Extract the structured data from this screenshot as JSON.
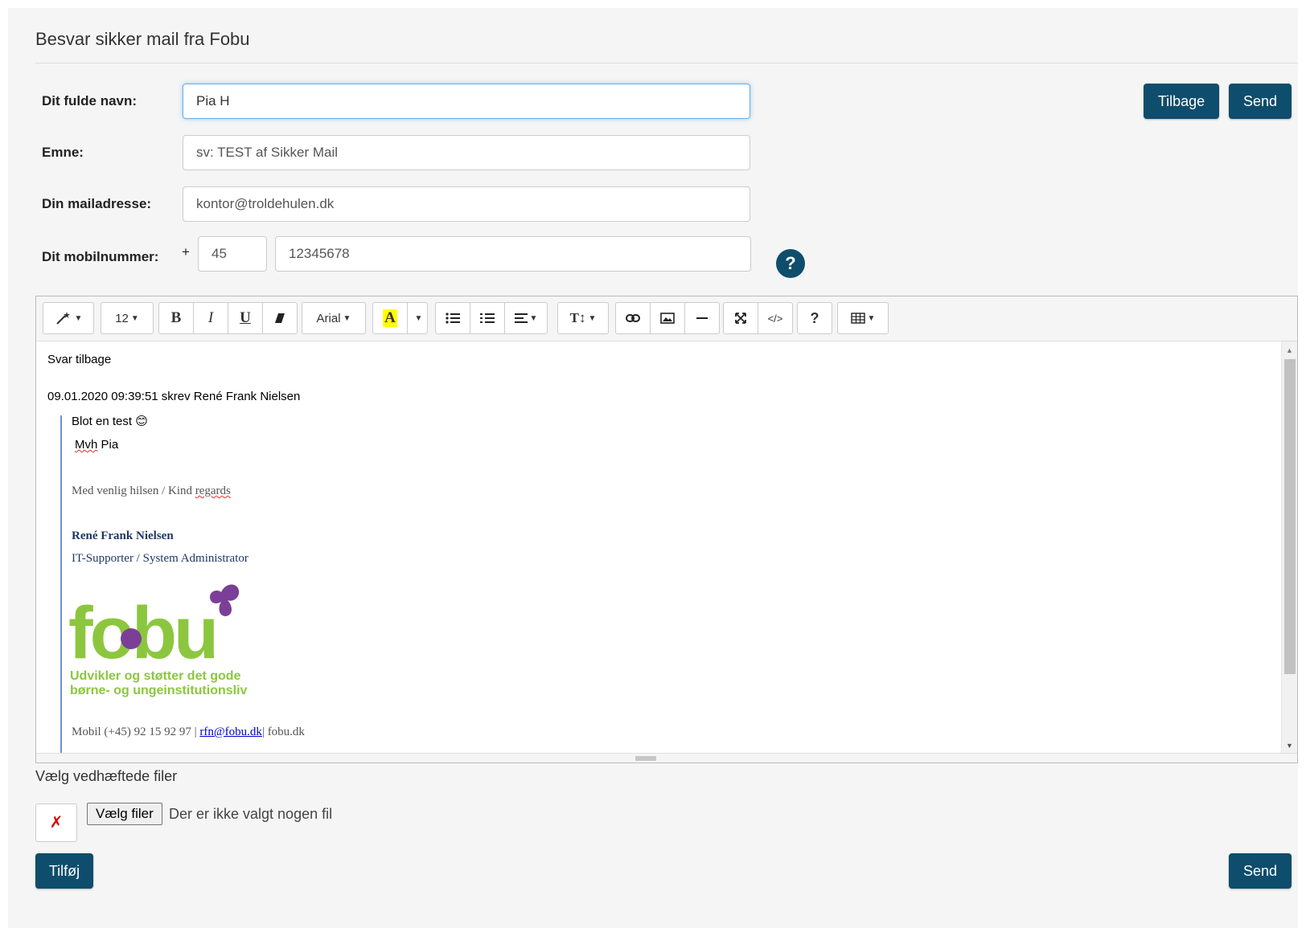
{
  "page": {
    "title": "Besvar sikker mail fra Fobu"
  },
  "form": {
    "name_label": "Dit fulde navn:",
    "name_value": "Pia H",
    "subject_label": "Emne:",
    "subject_value": "sv: TEST af Sikker Mail",
    "email_label": "Din mailadresse:",
    "email_value": "kontor@troldehulen.dk",
    "mobile_label": "Dit mobilnummer:",
    "mobile_plus": "+",
    "mobile_prefix": "45",
    "mobile_number": "12345678",
    "help_symbol": "?"
  },
  "header_buttons": {
    "back": "Tilbage",
    "send": "Send"
  },
  "toolbar": {
    "magic": "magic-wand-icon",
    "font_size": "12",
    "bold": "B",
    "italic": "I",
    "underline": "U",
    "eraser": "eraser-icon",
    "font_name": "Arial",
    "color": "A",
    "highlight_color": "#ffff00",
    "unordered_list": "unordered-list-icon",
    "ordered_list": "ordered-list-icon",
    "align": "align-icon",
    "line_height": "T↕",
    "link": "link-icon",
    "picture": "picture-icon",
    "hr": "horizontal-rule-icon",
    "fullscreen": "fullscreen-icon",
    "codeview": "</>",
    "help": "?",
    "table": "table-icon"
  },
  "editor": {
    "reply_text": "Svar tilbage",
    "quote_header": "09.01.2020 09:39:51 skrev René Frank Nielsen",
    "line1": "Blot en test",
    "emoji": "😊",
    "greeting_word": "Mvh",
    "greeting_name": " Pia",
    "regards_prefix": "Med venlig hilsen / Kind ",
    "regards_word": "regards",
    "sig_name": "René Frank Nielsen",
    "sig_title": "IT-Supporter / System Administrator",
    "logo_text": "fobu",
    "tagline1": "Udvikler og støtter det gode",
    "tagline2": "børne- og ungeinstitutionsliv",
    "contact_prefix": "Mobil (+45) 92 15 92 97 | ",
    "contact_email": "rfn@fobu.dk",
    "contact_suffix": "| fobu.dk"
  },
  "attachments": {
    "label": "Vælg vedhæftede filer",
    "remove_symbol": "✗",
    "choose_button": "Vælg filer",
    "status": "Der er ikke valgt nogen fil"
  },
  "footer": {
    "add": "Tilføj",
    "send": "Send"
  },
  "colors": {
    "primary": "#0e4d6c",
    "logo_green": "#8cc63f",
    "logo_purple": "#7b3f98",
    "quote_border": "#6f8fd8",
    "signature_blue": "#1f3864"
  }
}
